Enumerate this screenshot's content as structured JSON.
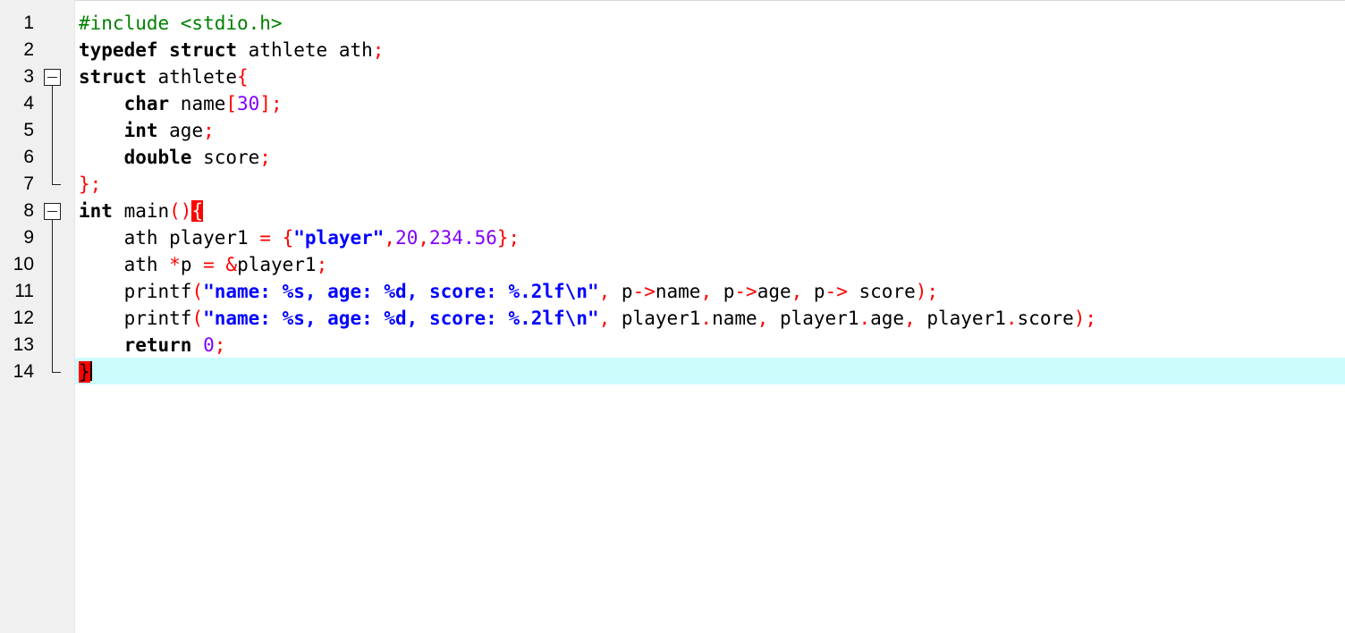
{
  "editor": {
    "current_line": 14,
    "lines": [
      {
        "number": "1",
        "tokens": [
          [
            "pre",
            "#include <stdio.h>"
          ]
        ]
      },
      {
        "number": "2",
        "tokens": [
          [
            "kw",
            "typedef"
          ],
          [
            "id",
            " "
          ],
          [
            "kw",
            "struct"
          ],
          [
            "id",
            " athlete ath"
          ],
          [
            "op",
            ";"
          ]
        ]
      },
      {
        "number": "3",
        "tokens": [
          [
            "kw",
            "struct"
          ],
          [
            "id",
            " athlete"
          ],
          [
            "op",
            "{"
          ]
        ]
      },
      {
        "number": "4",
        "tokens": [
          [
            "id",
            "    "
          ],
          [
            "kw",
            "char"
          ],
          [
            "id",
            " name"
          ],
          [
            "op",
            "["
          ],
          [
            "num",
            "30"
          ],
          [
            "op",
            "];"
          ]
        ]
      },
      {
        "number": "5",
        "tokens": [
          [
            "id",
            "    "
          ],
          [
            "kw",
            "int"
          ],
          [
            "id",
            " age"
          ],
          [
            "op",
            ";"
          ]
        ]
      },
      {
        "number": "6",
        "tokens": [
          [
            "id",
            "    "
          ],
          [
            "kw",
            "double"
          ],
          [
            "id",
            " score"
          ],
          [
            "op",
            ";"
          ]
        ]
      },
      {
        "number": "7",
        "tokens": [
          [
            "op",
            "};"
          ]
        ]
      },
      {
        "number": "8",
        "tokens": [
          [
            "kw",
            "int"
          ],
          [
            "id",
            " main"
          ],
          [
            "op",
            "()"
          ],
          [
            "brace-hl",
            "{"
          ]
        ]
      },
      {
        "number": "9",
        "tokens": [
          [
            "id",
            "    ath player1 "
          ],
          [
            "op",
            "="
          ],
          [
            "id",
            " "
          ],
          [
            "op",
            "{"
          ],
          [
            "str",
            "\"player\""
          ],
          [
            "op",
            ","
          ],
          [
            "num",
            "20"
          ],
          [
            "op",
            ","
          ],
          [
            "num",
            "234.56"
          ],
          [
            "op",
            "};"
          ]
        ]
      },
      {
        "number": "10",
        "tokens": [
          [
            "id",
            "    ath "
          ],
          [
            "op",
            "*"
          ],
          [
            "id",
            "p "
          ],
          [
            "op",
            "="
          ],
          [
            "id",
            " "
          ],
          [
            "op",
            "&"
          ],
          [
            "id",
            "player1"
          ],
          [
            "op",
            ";"
          ]
        ]
      },
      {
        "number": "11",
        "tokens": [
          [
            "id",
            "    printf"
          ],
          [
            "op",
            "("
          ],
          [
            "str",
            "\"name: %s, age: %d, score: %.2lf\\n\""
          ],
          [
            "op",
            ","
          ],
          [
            "id",
            " p"
          ],
          [
            "op",
            "->"
          ],
          [
            "id",
            "name"
          ],
          [
            "op",
            ","
          ],
          [
            "id",
            " p"
          ],
          [
            "op",
            "->"
          ],
          [
            "id",
            "age"
          ],
          [
            "op",
            ","
          ],
          [
            "id",
            " p"
          ],
          [
            "op",
            "->"
          ],
          [
            "id",
            " score"
          ],
          [
            "op",
            ");"
          ]
        ]
      },
      {
        "number": "12",
        "tokens": [
          [
            "id",
            "    printf"
          ],
          [
            "op",
            "("
          ],
          [
            "str",
            "\"name: %s, age: %d, score: %.2lf\\n\""
          ],
          [
            "op",
            ","
          ],
          [
            "id",
            " player1"
          ],
          [
            "op",
            "."
          ],
          [
            "id",
            "name"
          ],
          [
            "op",
            ","
          ],
          [
            "id",
            " player1"
          ],
          [
            "op",
            "."
          ],
          [
            "id",
            "age"
          ],
          [
            "op",
            ","
          ],
          [
            "id",
            " player1"
          ],
          [
            "op",
            "."
          ],
          [
            "id",
            "score"
          ],
          [
            "op",
            ");"
          ]
        ]
      },
      {
        "number": "13",
        "tokens": [
          [
            "id",
            "    "
          ],
          [
            "kw",
            "return"
          ],
          [
            "id",
            " "
          ],
          [
            "num",
            "0"
          ],
          [
            "op",
            ";"
          ]
        ]
      },
      {
        "number": "14",
        "tokens": [
          [
            "brace-hl-dark",
            "}"
          ]
        ]
      }
    ]
  }
}
